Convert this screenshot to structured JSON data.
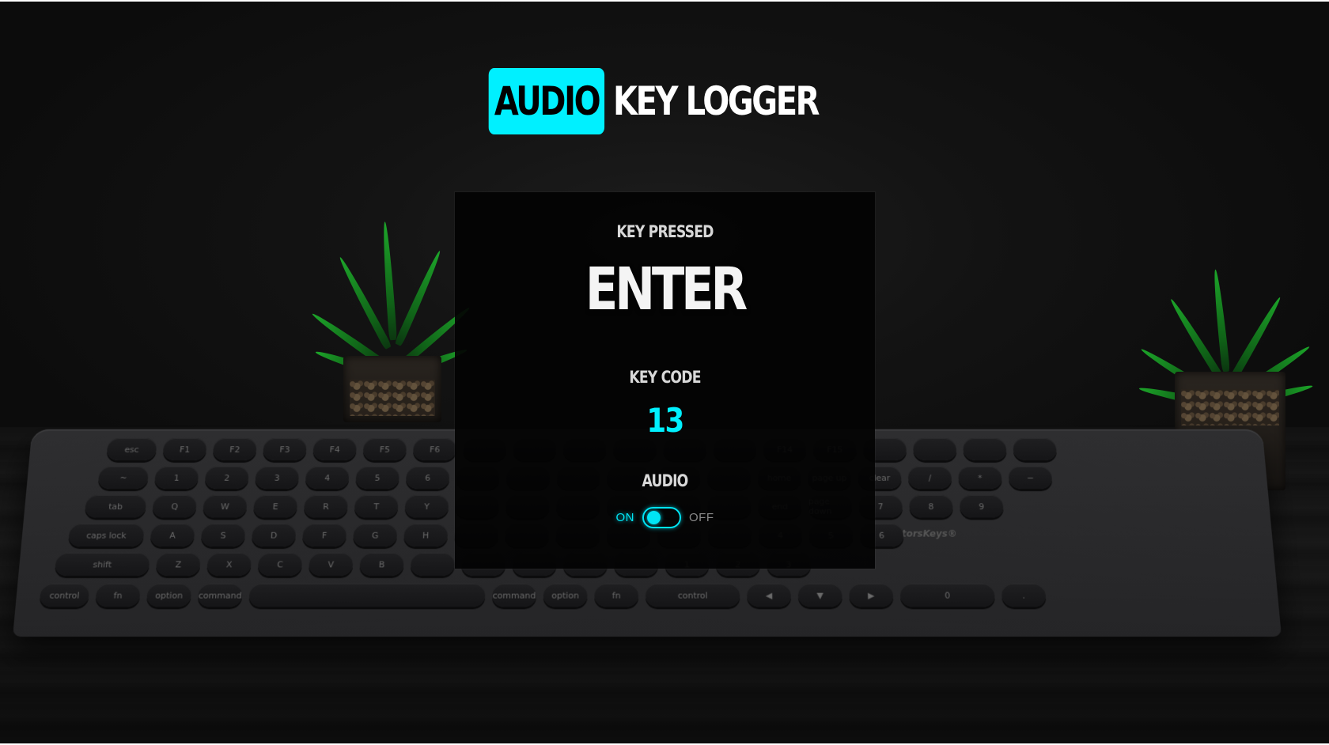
{
  "header": {
    "badge": "AUDIO",
    "title": "KEY LOGGER"
  },
  "panel": {
    "key_pressed_label": "KEY PRESSED",
    "key_pressed_value": "ENTER",
    "key_code_label": "KEY CODE",
    "key_code_value": "13",
    "audio_label": "AUDIO",
    "toggle_on_label": "ON",
    "toggle_off_label": "OFF",
    "audio_enabled": true
  },
  "keyboard": {
    "brand": "EditorsKeys®",
    "rows": [
      [
        "esc",
        "F1",
        "F2",
        "F3",
        "F4",
        "F5",
        "F6",
        "",
        "",
        "",
        "",
        "",
        "",
        "F14",
        "F15",
        "",
        "",
        "",
        ""
      ],
      [
        "~",
        "1",
        "2",
        "3",
        "4",
        "5",
        "6",
        "",
        "",
        "",
        "",
        "",
        "",
        "home",
        "page up",
        "clear",
        "/",
        "*",
        "−"
      ],
      [
        "tab",
        "Q",
        "W",
        "E",
        "R",
        "T",
        "Y",
        "",
        "",
        "",
        "",
        "",
        "",
        "end",
        "page down",
        "7",
        "8",
        "9"
      ],
      [
        "caps lock",
        "A",
        "S",
        "D",
        "F",
        "G",
        "H",
        "",
        "",
        "",
        "",
        "",
        "",
        "4",
        "5",
        "6"
      ],
      [
        "shift",
        "Z",
        "X",
        "C",
        "V",
        "B",
        "",
        "",
        "",
        "",
        "",
        "1",
        "2",
        "3"
      ],
      [
        "control",
        "fn",
        "option",
        "command",
        "",
        "command",
        "option",
        "fn",
        "control",
        "◀",
        "▼",
        "▶",
        "0",
        "."
      ]
    ]
  },
  "colors": {
    "accent": "#00f0ff",
    "panel_bg": "#030303",
    "text": "#f4f4f4"
  }
}
